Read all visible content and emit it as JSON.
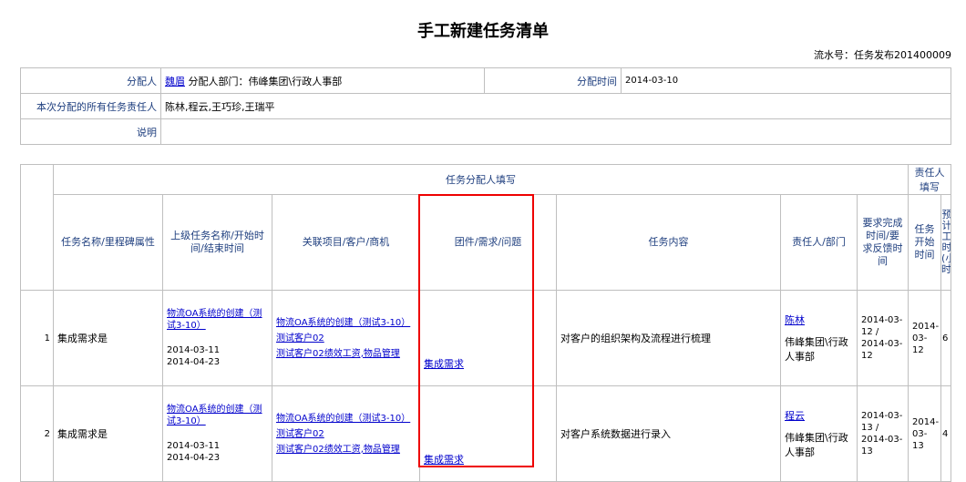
{
  "page": {
    "title": "手工新建任务清单",
    "serial_label": "流水号：任务发布201400009"
  },
  "info": {
    "assigner_label": "分配人",
    "assigner_name": "魏眉",
    "assigner_dept": " 分配人部门：伟峰集团\\行政人事部",
    "assign_time_label": "分配时间",
    "assign_time": "2014-03-10",
    "responsible_label": "本次分配的所有任务责任人",
    "responsible_value": "陈林,程云,王巧珍,王瑞平",
    "desc_label": "说明",
    "desc_value": ""
  },
  "table": {
    "group_assigner": "任务分配人填写",
    "group_responsible": "责任人填写",
    "columns": [
      "任务名称/里程碑属性",
      "上级任务名称/开始时间/结束时间",
      "关联项目/客户/商机",
      "团件/需求/问题",
      "任务内容",
      "责任人/部门",
      "要求完成时间/要求反馈时间",
      "任务开始时间",
      "预计工时(小时)"
    ],
    "rows": [
      {
        "no": "1",
        "name": "集成需求是",
        "parent_task": "物流OA系统的创建（测试3-10）",
        "start": "2014-03-11",
        "end": "2014-04-23",
        "project": "物流OA系统的创建（测试3-10）",
        "customer": "测试客户02",
        "opportunity": "测试客户02绩效工资,物品管理",
        "req": "集成需求",
        "content": "对客户的组织架构及流程进行梳理",
        "person": "陈林",
        "dept": "伟峰集团\\行政人事部",
        "due": "2014-03-12 / 2014-03-12",
        "task_start": "2014-03-12",
        "hours": "6"
      },
      {
        "no": "2",
        "name": "集成需求是",
        "parent_task": "物流OA系统的创建（测试3-10）",
        "start": "2014-03-11",
        "end": "2014-04-23",
        "project": "物流OA系统的创建（测试3-10）",
        "customer": "测试客户02",
        "opportunity": "测试客户02绩效工资,物品管理",
        "req": "集成需求",
        "content": "对客户系统数据进行录入",
        "person": "程云",
        "dept": "伟峰集团\\行政人事部",
        "due": "2014-03-13 / 2014-03-13",
        "task_start": "2014-03-13",
        "hours": "4"
      }
    ]
  },
  "colors": {
    "highlight": "#e00000",
    "link": "#0000cc",
    "label": "#1f3f7f"
  }
}
